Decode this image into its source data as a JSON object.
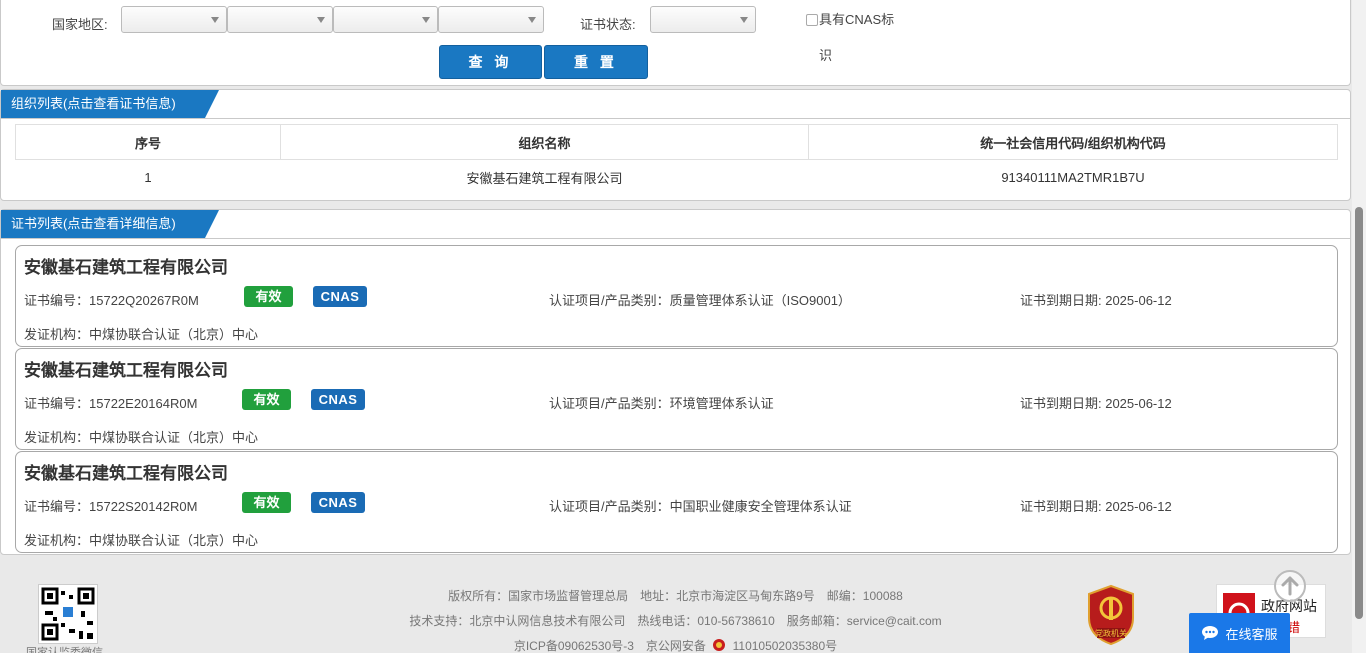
{
  "search": {
    "country_label": "国家地区:",
    "status_label": "证书状态:",
    "cnas_label": "具有CNAS标识",
    "query_button": "查 询",
    "reset_button": "重 置"
  },
  "org_section": {
    "tab": "组织列表(点击查看证书信息)",
    "headers": [
      "序号",
      "组织名称",
      "统一社会信用代码/组织机构代码"
    ],
    "rows": [
      {
        "no": "1",
        "name": "安徽基石建筑工程有限公司",
        "code": "91340111MA2TMR1B7U"
      }
    ]
  },
  "cert_section": {
    "tab": "证书列表(点击查看详细信息)",
    "cards": [
      {
        "title": "安徽基石建筑工程有限公司",
        "cert_no": "证书编号：15722Q20267R0M",
        "status": "有效",
        "cnas": "CNAS",
        "project": "认证项目/产品类别：质量管理体系认证（ISO9001）",
        "expiry": "证书到期日期: 2025-06-12",
        "issuer": "发证机构：中煤协联合认证（北京）中心"
      },
      {
        "title": "安徽基石建筑工程有限公司",
        "cert_no": "证书编号：15722E20164R0M",
        "status": "有效",
        "cnas": "CNAS",
        "project": "认证项目/产品类别：环境管理体系认证",
        "expiry": "证书到期日期: 2025-06-12",
        "issuer": "发证机构：中煤协联合认证（北京）中心"
      },
      {
        "title": "安徽基石建筑工程有限公司",
        "cert_no": "证书编号：15722S20142R0M",
        "status": "有效",
        "cnas": "CNAS",
        "project": "认证项目/产品类别：中国职业健康安全管理体系认证",
        "expiry": "证书到期日期: 2025-06-12",
        "issuer": "发证机构：中煤协联合认证（北京）中心"
      }
    ]
  },
  "footer": {
    "line1": "版权所有：国家市场监督管理总局　地址：北京市海淀区马甸东路9号　邮编：100088",
    "line2": "技术支持：北京中认网信息技术有限公司　热线电话：010-56738610　服务邮箱：service@cait.com",
    "line3a": "京ICP备09062530号-3　京公网安备",
    "line3b": "11010502035380号",
    "qr_caption": "国家认监委微信",
    "emblem_text": "党政机关",
    "gov_text": "政府网站",
    "gov_sub": "错",
    "chat_label": "在线客服"
  },
  "colors": {
    "accent": "#1a78c2",
    "valid": "#21a03d",
    "cnas": "#1a6bb5",
    "chat": "#1a78e8"
  }
}
